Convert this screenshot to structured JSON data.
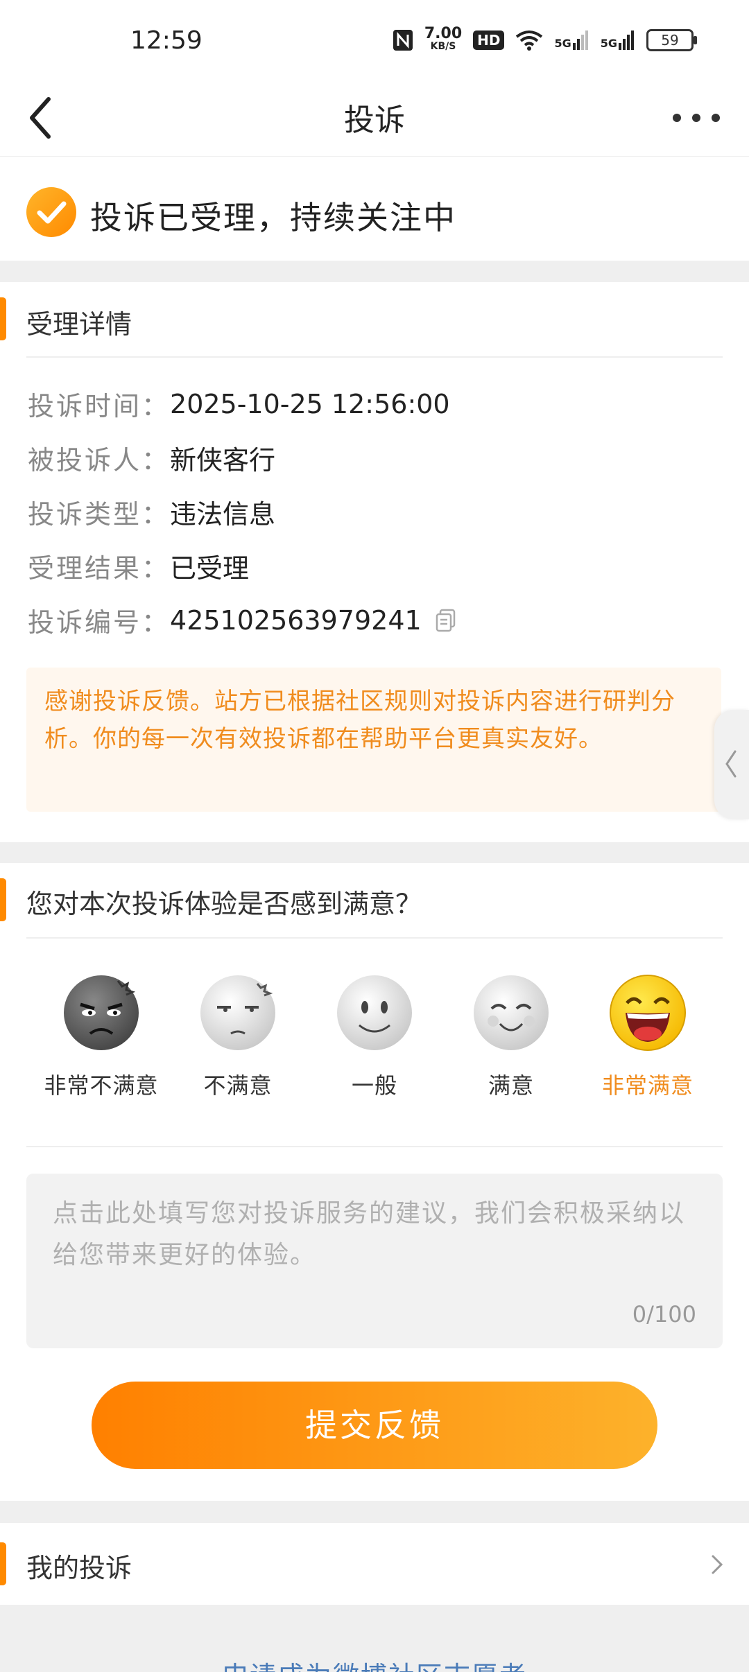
{
  "status_bar": {
    "time": "12:59",
    "net_speed": "7.00",
    "net_unit": "KB/S",
    "hd": "HD",
    "signal1": "5G",
    "signal2": "5G",
    "battery": "59"
  },
  "nav": {
    "title": "投诉"
  },
  "banner": {
    "text": "投诉已受理，持续关注中"
  },
  "details": {
    "heading": "受理详情",
    "rows": [
      {
        "key": "投诉时间：",
        "value": "2025-10-25 12:56:00"
      },
      {
        "key": "被投诉人：",
        "value": "新侠客行"
      },
      {
        "key": "投诉类型：",
        "value": "违法信息"
      },
      {
        "key": "受理结果：",
        "value": "已受理"
      },
      {
        "key": "投诉编号：",
        "value": "425102563979241"
      }
    ],
    "notice": "感谢投诉反馈。站方已根据社区规则对投诉内容进行研判分析。你的每一次有效投诉都在帮助平台更真实友好。"
  },
  "survey": {
    "heading": "您对本次投诉体验是否感到满意？",
    "options": [
      {
        "label": "非常不满意",
        "icon": "very-dissatisfied-face-icon"
      },
      {
        "label": "不满意",
        "icon": "dissatisfied-face-icon"
      },
      {
        "label": "一般",
        "icon": "neutral-face-icon"
      },
      {
        "label": "满意",
        "icon": "satisfied-face-icon"
      },
      {
        "label": "非常满意",
        "icon": "very-satisfied-face-icon"
      }
    ],
    "selected": "非常满意",
    "placeholder": "点击此处填写您对投诉服务的建议，我们会积极采纳以给您带来更好的体验。",
    "counter": "0/100",
    "submit": "提交反馈"
  },
  "my_complaints": {
    "label": "我的投诉"
  },
  "footer": {
    "link": "申请成为微博社区志愿者"
  },
  "colors": {
    "accent": "#ff8a00",
    "notice_bg": "#fff7ee",
    "notice_text": "#f08c1e"
  }
}
